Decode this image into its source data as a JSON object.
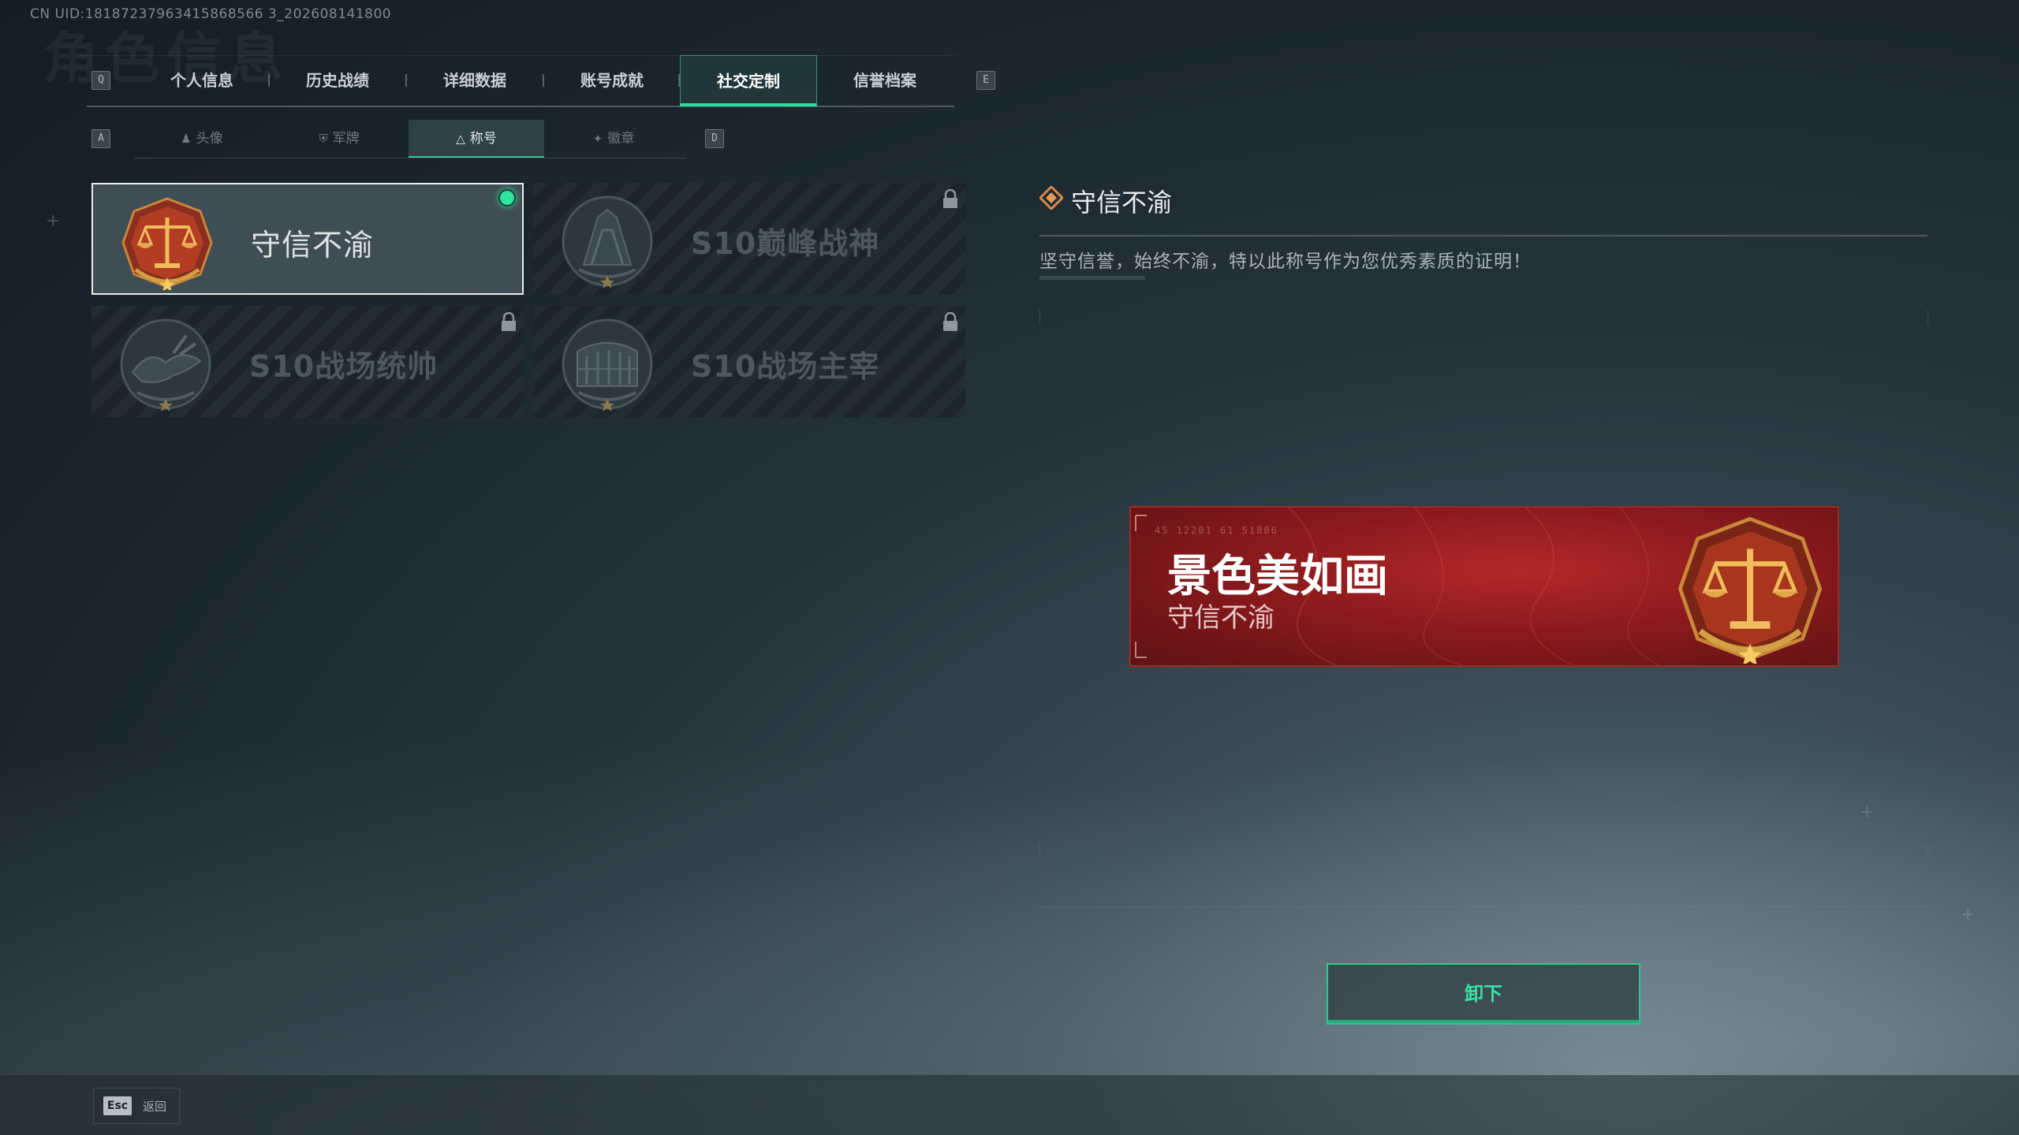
{
  "uid": "CN UID:18187237963415868566 3_202608141800",
  "page_title_bg": "角色信息",
  "tabs": {
    "left_key": "Q",
    "right_key": "E",
    "items": [
      {
        "label": "个人信息"
      },
      {
        "label": "历史战绩"
      },
      {
        "label": "详细数据"
      },
      {
        "label": "账号成就"
      },
      {
        "label": "社交定制",
        "active": true
      },
      {
        "label": "信誉档案"
      }
    ]
  },
  "subtabs": {
    "left_key": "A",
    "right_key": "D",
    "items": [
      {
        "label": "头像",
        "icon": "person-icon"
      },
      {
        "label": "军牌",
        "icon": "shield-icon"
      },
      {
        "label": "称号",
        "icon": "triangle-icon",
        "active": true
      },
      {
        "label": "徽章",
        "icon": "wings-icon"
      }
    ]
  },
  "titles": [
    {
      "name": "守信不渝",
      "emblem": "scales-emblem",
      "selected": true,
      "equipped": true,
      "locked": false
    },
    {
      "name": "S10巅峰战神",
      "emblem": "peak-emblem",
      "selected": false,
      "equipped": false,
      "locked": true
    },
    {
      "name": "S10战场统帅",
      "emblem": "beast-emblem",
      "selected": false,
      "equipped": false,
      "locked": true
    },
    {
      "name": "S10战场主宰",
      "emblem": "colosseum-emblem",
      "selected": false,
      "equipped": false,
      "locked": true
    }
  ],
  "detail": {
    "title": "守信不渝",
    "description": "坚守信誉，始终不渝，特以此称号作为您优秀素质的证明！"
  },
  "banner": {
    "player_name": "景色美如画",
    "title": "守信不渝"
  },
  "actions": {
    "unequip": "卸下",
    "esc_key": "Esc",
    "back": "返回"
  },
  "colors": {
    "accent": "#35e3a2",
    "banner_red": "#9c1f22",
    "gold": "#d8a24a"
  }
}
